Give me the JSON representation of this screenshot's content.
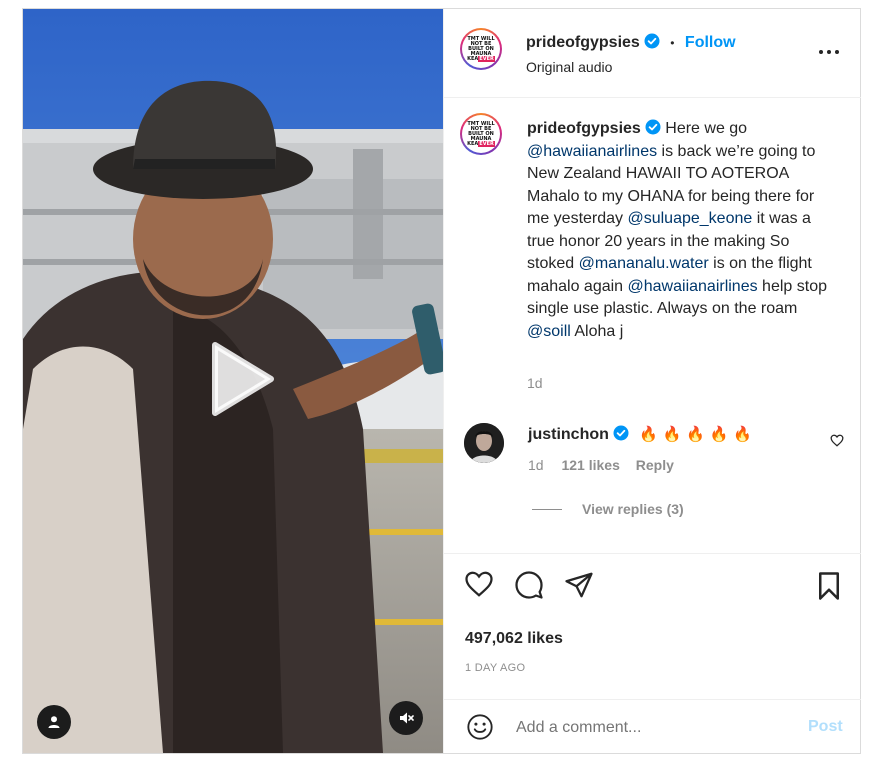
{
  "post": {
    "username": "prideofgypsies",
    "follow_label": "Follow",
    "separator": "•",
    "audio": "Original audio",
    "avatar_text": [
      "TMT WILL",
      "NOT BE",
      "BUILT ON",
      "MAUNA",
      "KEA"
    ],
    "avatar_badge": "EVER",
    "more_icon": "more-horizontal-icon"
  },
  "caption": {
    "username": "prideofgypsies",
    "p1": " Here we go ",
    "m1": "@hawaiianairlines",
    "p2": " is back we’re going to New Zealand HAWAII TO AOTEROA Mahalo to my OHANA for being there for me yesterday ",
    "m2": "@suluape_keone",
    "p3": " it was a true honor 20 years in the making So stoked ",
    "m3": "@mananalu.water",
    "p4": " is on the flight mahalo again ",
    "m4": "@hawaiianairlines",
    "p5": " help stop single use plastic. Always on the roam ",
    "m5": "@soill",
    "p6": " Aloha j",
    "time": "1d"
  },
  "comment": {
    "username": "justinchon",
    "text": "🔥 🔥 🔥 🔥 🔥",
    "time": "1d",
    "likes": "121 likes",
    "reply": "Reply",
    "view_replies": "View replies (3)"
  },
  "stats": {
    "likes": "497,062 likes",
    "date": "1 DAY AGO"
  },
  "composer": {
    "placeholder": "Add a comment...",
    "post_label": "Post"
  },
  "colors": {
    "accent": "#0095f6",
    "link": "#00376b",
    "muted": "#8e8e8e",
    "post_disabled": "#b2dffc"
  }
}
